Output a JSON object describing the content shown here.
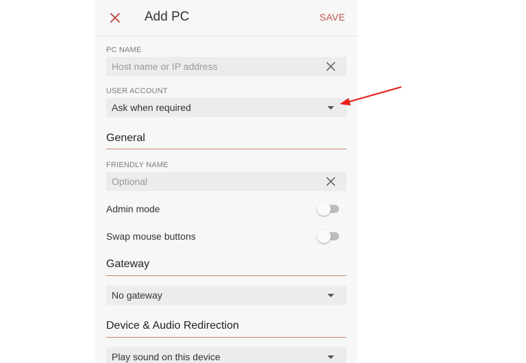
{
  "header": {
    "close_icon": "close-icon",
    "title": "Add PC",
    "save_label": "SAVE"
  },
  "pc_name": {
    "caption": "PC NAME",
    "placeholder": "Host name or IP address"
  },
  "user_account": {
    "caption": "USER ACCOUNT",
    "value": "Ask when required"
  },
  "general": {
    "heading": "General",
    "friendly_name": {
      "caption": "FRIENDLY NAME",
      "placeholder": "Optional"
    },
    "admin_mode": {
      "label": "Admin mode",
      "enabled": false
    },
    "swap_mouse": {
      "label": "Swap mouse buttons",
      "enabled": false
    }
  },
  "gateway": {
    "heading": "Gateway",
    "value": "No gateway"
  },
  "redirection": {
    "heading": "Device & Audio Redirection",
    "sound_value": "Play sound on this device"
  },
  "colors": {
    "accent": "#c0504d",
    "annotation_arrow": "#e8201d",
    "section_rule": "#c9846b"
  }
}
